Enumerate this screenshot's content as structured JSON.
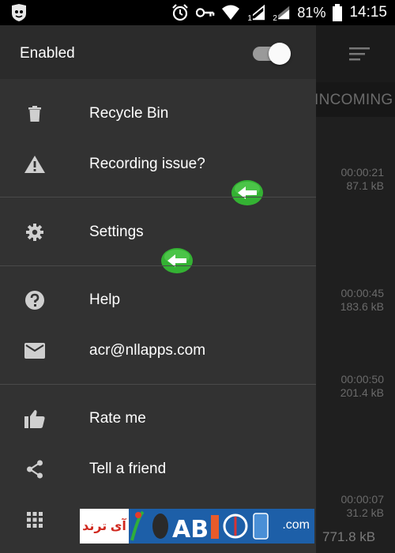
{
  "status_bar": {
    "battery": "81%",
    "time": "14:15",
    "sim1": "1",
    "sim2": "2"
  },
  "drawer": {
    "header": {
      "label": "Enabled",
      "toggle_on": true
    },
    "items": [
      {
        "label": "Recycle Bin",
        "icon": "trash-icon"
      },
      {
        "label": "Recording issue?",
        "icon": "warning-icon"
      },
      {
        "label": "Settings",
        "icon": "gear-icon"
      },
      {
        "label": "Help",
        "icon": "help-icon"
      },
      {
        "label": "acr@nllapps.com",
        "icon": "mail-icon"
      },
      {
        "label": "Rate me",
        "icon": "thumbs-up-icon"
      },
      {
        "label": "Tell a friend",
        "icon": "share-icon"
      },
      {
        "label": "",
        "icon": "apps-grid-icon"
      }
    ]
  },
  "background": {
    "tab_label": "INCOMING",
    "entries": [
      {
        "duration": "00:00:21",
        "size": "87.1 kB"
      },
      {
        "duration": "00:00:45",
        "size": "183.6 kB"
      },
      {
        "duration": "00:00:50",
        "size": "201.4 kB"
      },
      {
        "duration": "00:00:07",
        "size": "31.2 kB"
      }
    ],
    "bottom_size": "771.8 kB"
  },
  "watermark": {
    "persian_text": "آی ترند",
    "domain": ".com",
    "letters": "AB"
  },
  "colors": {
    "drawer_bg": "#323232",
    "header_bg": "#2b2b2b",
    "accent_green": "#34b233",
    "divider": "#4a4a4a"
  }
}
